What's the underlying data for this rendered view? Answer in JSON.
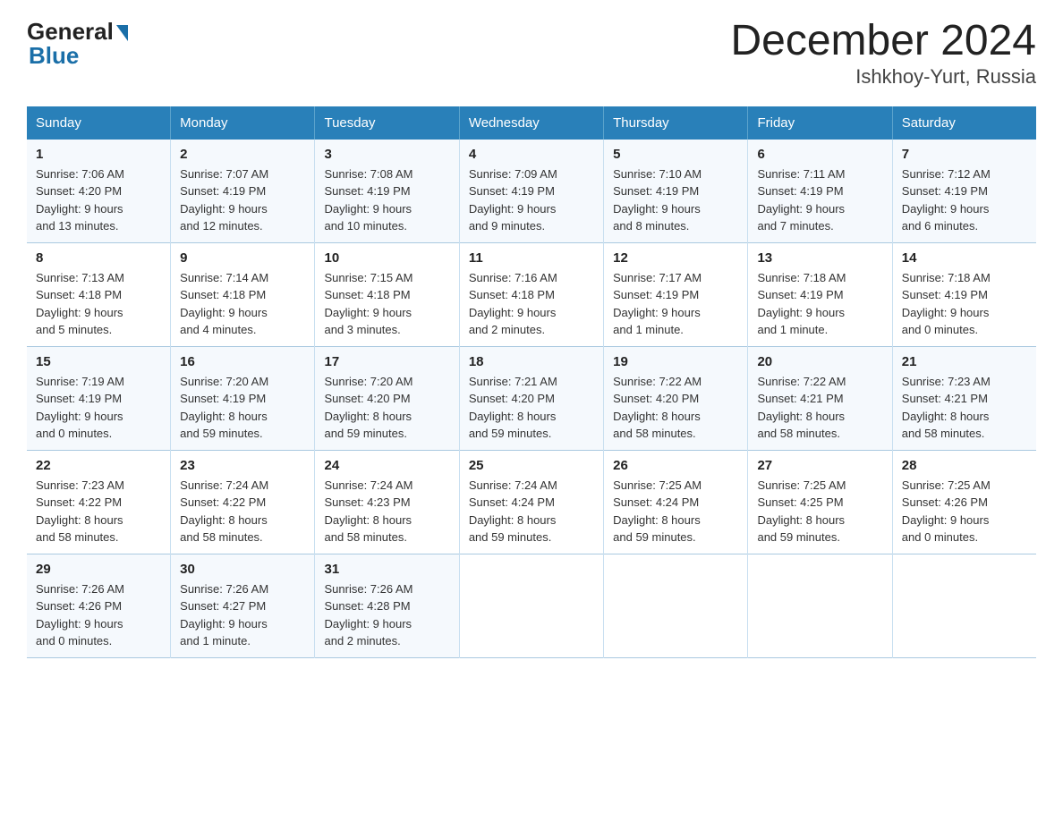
{
  "logo": {
    "general": "General",
    "blue": "Blue"
  },
  "title": "December 2024",
  "subtitle": "Ishkhoy-Yurt, Russia",
  "days_header": [
    "Sunday",
    "Monday",
    "Tuesday",
    "Wednesday",
    "Thursday",
    "Friday",
    "Saturday"
  ],
  "weeks": [
    [
      {
        "num": "1",
        "sunrise": "7:06 AM",
        "sunset": "4:20 PM",
        "daylight": "9 hours and 13 minutes."
      },
      {
        "num": "2",
        "sunrise": "7:07 AM",
        "sunset": "4:19 PM",
        "daylight": "9 hours and 12 minutes."
      },
      {
        "num": "3",
        "sunrise": "7:08 AM",
        "sunset": "4:19 PM",
        "daylight": "9 hours and 10 minutes."
      },
      {
        "num": "4",
        "sunrise": "7:09 AM",
        "sunset": "4:19 PM",
        "daylight": "9 hours and 9 minutes."
      },
      {
        "num": "5",
        "sunrise": "7:10 AM",
        "sunset": "4:19 PM",
        "daylight": "9 hours and 8 minutes."
      },
      {
        "num": "6",
        "sunrise": "7:11 AM",
        "sunset": "4:19 PM",
        "daylight": "9 hours and 7 minutes."
      },
      {
        "num": "7",
        "sunrise": "7:12 AM",
        "sunset": "4:19 PM",
        "daylight": "9 hours and 6 minutes."
      }
    ],
    [
      {
        "num": "8",
        "sunrise": "7:13 AM",
        "sunset": "4:18 PM",
        "daylight": "9 hours and 5 minutes."
      },
      {
        "num": "9",
        "sunrise": "7:14 AM",
        "sunset": "4:18 PM",
        "daylight": "9 hours and 4 minutes."
      },
      {
        "num": "10",
        "sunrise": "7:15 AM",
        "sunset": "4:18 PM",
        "daylight": "9 hours and 3 minutes."
      },
      {
        "num": "11",
        "sunrise": "7:16 AM",
        "sunset": "4:18 PM",
        "daylight": "9 hours and 2 minutes."
      },
      {
        "num": "12",
        "sunrise": "7:17 AM",
        "sunset": "4:19 PM",
        "daylight": "9 hours and 1 minute."
      },
      {
        "num": "13",
        "sunrise": "7:18 AM",
        "sunset": "4:19 PM",
        "daylight": "9 hours and 1 minute."
      },
      {
        "num": "14",
        "sunrise": "7:18 AM",
        "sunset": "4:19 PM",
        "daylight": "9 hours and 0 minutes."
      }
    ],
    [
      {
        "num": "15",
        "sunrise": "7:19 AM",
        "sunset": "4:19 PM",
        "daylight": "9 hours and 0 minutes."
      },
      {
        "num": "16",
        "sunrise": "7:20 AM",
        "sunset": "4:19 PM",
        "daylight": "8 hours and 59 minutes."
      },
      {
        "num": "17",
        "sunrise": "7:20 AM",
        "sunset": "4:20 PM",
        "daylight": "8 hours and 59 minutes."
      },
      {
        "num": "18",
        "sunrise": "7:21 AM",
        "sunset": "4:20 PM",
        "daylight": "8 hours and 59 minutes."
      },
      {
        "num": "19",
        "sunrise": "7:22 AM",
        "sunset": "4:20 PM",
        "daylight": "8 hours and 58 minutes."
      },
      {
        "num": "20",
        "sunrise": "7:22 AM",
        "sunset": "4:21 PM",
        "daylight": "8 hours and 58 minutes."
      },
      {
        "num": "21",
        "sunrise": "7:23 AM",
        "sunset": "4:21 PM",
        "daylight": "8 hours and 58 minutes."
      }
    ],
    [
      {
        "num": "22",
        "sunrise": "7:23 AM",
        "sunset": "4:22 PM",
        "daylight": "8 hours and 58 minutes."
      },
      {
        "num": "23",
        "sunrise": "7:24 AM",
        "sunset": "4:22 PM",
        "daylight": "8 hours and 58 minutes."
      },
      {
        "num": "24",
        "sunrise": "7:24 AM",
        "sunset": "4:23 PM",
        "daylight": "8 hours and 58 minutes."
      },
      {
        "num": "25",
        "sunrise": "7:24 AM",
        "sunset": "4:24 PM",
        "daylight": "8 hours and 59 minutes."
      },
      {
        "num": "26",
        "sunrise": "7:25 AM",
        "sunset": "4:24 PM",
        "daylight": "8 hours and 59 minutes."
      },
      {
        "num": "27",
        "sunrise": "7:25 AM",
        "sunset": "4:25 PM",
        "daylight": "8 hours and 59 minutes."
      },
      {
        "num": "28",
        "sunrise": "7:25 AM",
        "sunset": "4:26 PM",
        "daylight": "9 hours and 0 minutes."
      }
    ],
    [
      {
        "num": "29",
        "sunrise": "7:26 AM",
        "sunset": "4:26 PM",
        "daylight": "9 hours and 0 minutes."
      },
      {
        "num": "30",
        "sunrise": "7:26 AM",
        "sunset": "4:27 PM",
        "daylight": "9 hours and 1 minute."
      },
      {
        "num": "31",
        "sunrise": "7:26 AM",
        "sunset": "4:28 PM",
        "daylight": "9 hours and 2 minutes."
      },
      null,
      null,
      null,
      null
    ]
  ],
  "labels": {
    "sunrise": "Sunrise:",
    "sunset": "Sunset:",
    "daylight": "Daylight:"
  }
}
